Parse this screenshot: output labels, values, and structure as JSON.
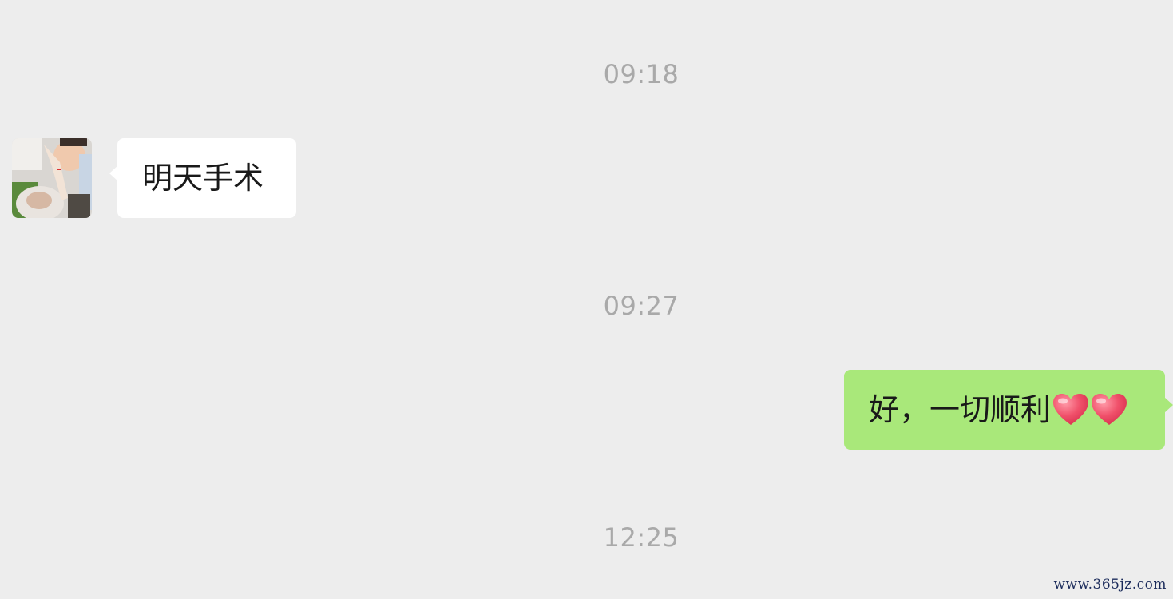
{
  "timestamps": [
    "09:18",
    "09:27",
    "12:25"
  ],
  "messages": [
    {
      "direction": "incoming",
      "text": "明天手术"
    },
    {
      "direction": "outgoing",
      "text": "好，一切顺利",
      "emoji": [
        "red-heart",
        "red-heart"
      ]
    }
  ],
  "colors": {
    "background": "#ededed",
    "incoming_bubble": "#ffffff",
    "outgoing_bubble": "#a9e87a",
    "timestamp_text": "#a9a9a9"
  },
  "watermark": "www.365jz.com"
}
